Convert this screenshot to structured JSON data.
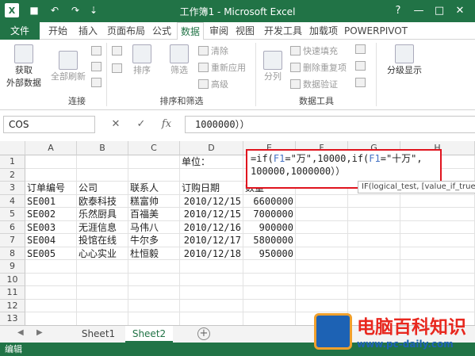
{
  "window": {
    "title": "工作簿1 - Microsoft Excel",
    "help": "?",
    "minimize": "—",
    "restore": "□",
    "close": "✕"
  },
  "qat": {
    "save": "■",
    "undo": "↶",
    "redo": "↷",
    "more": "⇣"
  },
  "tabs": [
    "文件",
    "开始",
    "插入",
    "页面布局",
    "公式",
    "数据",
    "审阅",
    "视图",
    "开发工具",
    "加载项",
    "POWERPIVOT"
  ],
  "active_tab": "数据",
  "ribbon": {
    "get_external_data": [
      "获取",
      "外部数据"
    ],
    "refresh_all": "全部刷新",
    "sort": "排序",
    "filter": "筛选",
    "clear": "清除",
    "reapply": "重新应用",
    "advanced": "高级",
    "text_to_columns": "分列",
    "flash_fill": "快速填充",
    "remove_duplicates": "删除重复项",
    "data_validation": "数据验证",
    "outline": "分级显示",
    "groups": {
      "connections": "连接",
      "sort_filter": "排序和筛选",
      "data_tools": "数据工具"
    }
  },
  "formula_bar": {
    "name_box": "COS",
    "cancel": "✕",
    "enter": "✓",
    "fx": "fx",
    "content": "1000000））"
  },
  "grid": {
    "columns": [
      "A",
      "B",
      "C",
      "D",
      "E",
      "F",
      "G",
      "H"
    ],
    "rows": [
      "1",
      "2",
      "3",
      "4",
      "5",
      "6",
      "7",
      "8",
      "9",
      "10",
      "11",
      "12",
      "13"
    ],
    "d1": "单位：",
    "headers": [
      "订单编号",
      "公司",
      "联系人",
      "订购日期",
      "数量"
    ],
    "data": [
      [
        "SE001",
        "欧泰科技",
        "糕富帅",
        "2010/12/15",
        "6600000"
      ],
      [
        "SE002",
        "乐然厨具",
        "百福美",
        "2010/12/15",
        "7000000"
      ],
      [
        "SE003",
        "无涯信息",
        "马伟八",
        "2010/12/16",
        "900000"
      ],
      [
        "SE004",
        "投馆在线",
        "牛尔多",
        "2010/12/17",
        "5800000"
      ],
      [
        "SE005",
        "心心实业",
        "杜恒毅",
        "2010/12/18",
        "950000"
      ]
    ],
    "edit_lines": [
      [
        "=if(",
        "F1",
        "=\"万\",10000,if(",
        "F1",
        "=\"十万\","
      ],
      [
        "100000,1000000））"
      ]
    ],
    "tooltip": "IF(logical_test, [value_if_true"
  },
  "sheets": [
    "Sheet1",
    "Sheet2"
  ],
  "active_sheet": "Sheet2",
  "add_sheet": "+",
  "status": "编辑",
  "watermark": {
    "name": "电脑百科知识",
    "url": "www.pc-daily.com"
  },
  "colors": {
    "accent": "#217346",
    "highlight": "#e0141e",
    "ref": "#4472c4"
  }
}
